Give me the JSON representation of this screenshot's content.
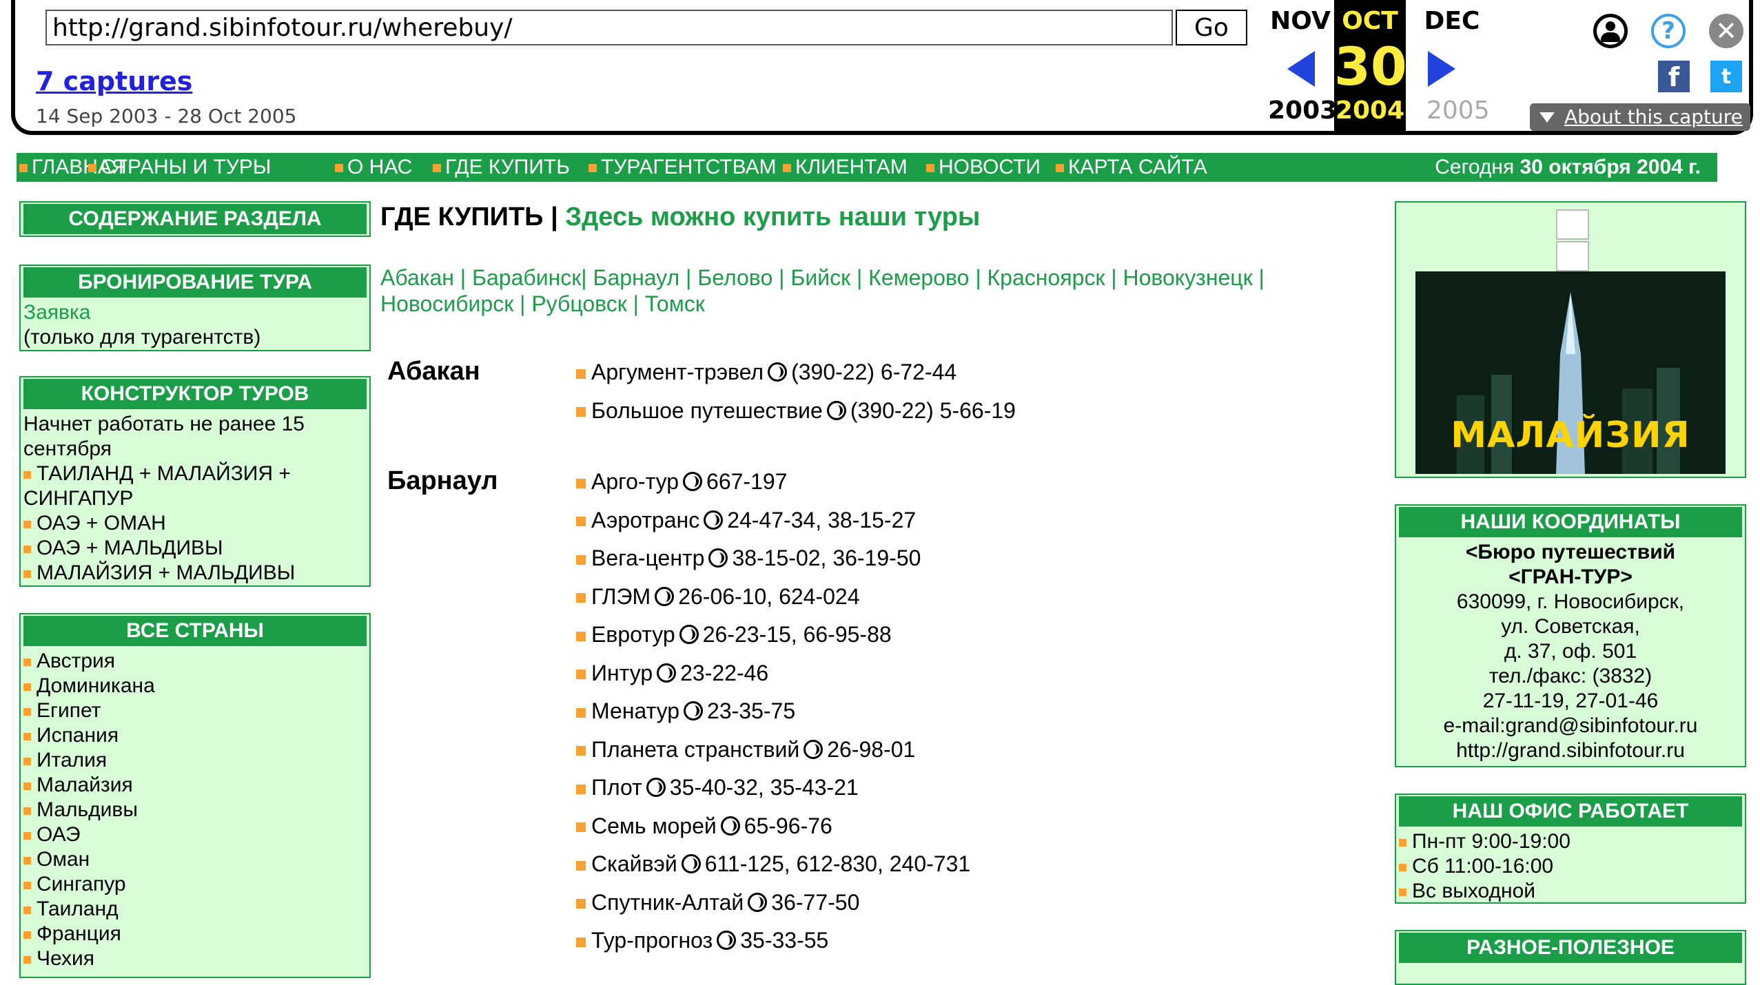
{
  "wayback": {
    "url": "http://grand.sibinfotour.ru/wherebuy/",
    "go_label": "Go",
    "captures": "7 captures",
    "date_range": "14 Sep 2003 - 28 Oct 2005",
    "prev_month": "NOV",
    "cur_month": "OCT",
    "next_month": "DEC",
    "cur_day": "30",
    "prev_year": "2003",
    "cur_year": "2004",
    "next_year": "2005",
    "about": "About this capture",
    "facebook": "f",
    "twitter": "t"
  },
  "nav": {
    "items": [
      "ГЛАВНАЯ",
      "СТРАНЫ И ТУРЫ",
      "О НАС",
      "ГДЕ КУПИТЬ",
      "ТУРАГЕНТСТВАМ",
      "КЛИЕНТАМ",
      "НОВОСТИ",
      "КАРТА САЙТА"
    ],
    "today_label": "Сегодня",
    "today_date": "30 октября 2004 г."
  },
  "left": {
    "contents_title": "СОДЕРЖАНИЕ РАЗДЕЛА",
    "booking_title": "БРОНИРОВАНИЕ ТУРА",
    "booking_link": "Заявка",
    "booking_note": "(только для турагентств)",
    "constructor_title": "КОНСТРУКТОР ТУРОВ",
    "constructor_note_1": "Начнет работать не ранее 15",
    "constructor_note_2": "сентября",
    "constructor_items": [
      "ТАИЛАНД + МАЛАЙЗИЯ +",
      "СИНГАПУР",
      "ОАЭ + ОМАН",
      "ОАЭ + МАЛЬДИВЫ",
      "МАЛАЙЗИЯ + МАЛЬДИВЫ"
    ],
    "countries_title": "ВСЕ СТРАНЫ",
    "countries": [
      "Австрия",
      "Доминикана",
      "Египет",
      "Испания",
      "Италия",
      "Малайзия",
      "Мальдивы",
      "ОАЭ",
      "Оман",
      "Сингапур",
      "Таиланд",
      "Франция",
      "Чехия"
    ]
  },
  "main": {
    "title": "ГДЕ КУПИТЬ",
    "separator": "|",
    "subtitle": "Здесь можно купить наши туры",
    "cities_line1": "Абакан | Барабинск| Барнаул | Белово | Бийск | Кемерово | Красноярск | Новокузнецк |",
    "cities_line2": "Новосибирск | Рубцовск | Томск",
    "sections": [
      {
        "city": "Абакан",
        "agencies": [
          {
            "name": "Аргумент-трэвел",
            "phone": "(390-22) 6-72-44"
          },
          {
            "name": "Большое путешествие",
            "phone": "(390-22) 5-66-19"
          }
        ]
      },
      {
        "city": "Барнаул",
        "agencies": [
          {
            "name": "Арго-тур",
            "phone": "667-197"
          },
          {
            "name": "Аэротранс",
            "phone": "24-47-34, 38-15-27"
          },
          {
            "name": "Вега-центр",
            "phone": "38-15-02, 36-19-50"
          },
          {
            "name": "ГЛЭМ",
            "phone": "26-06-10, 624-024"
          },
          {
            "name": "Евротур",
            "phone": "26-23-15, 66-95-88"
          },
          {
            "name": "Интур",
            "phone": "23-22-46"
          },
          {
            "name": "Менатур",
            "phone": "23-35-75"
          },
          {
            "name": "Планета странствий",
            "phone": "26-98-01"
          },
          {
            "name": "Плот",
            "phone": "35-40-32, 35-43-21"
          },
          {
            "name": "Семь морей",
            "phone": "65-96-76"
          },
          {
            "name": "Скайвэй",
            "phone": "611-125, 612-830, 240-731"
          },
          {
            "name": "Спутник-Алтай",
            "phone": "36-77-50"
          },
          {
            "name": "Тур-прогноз",
            "phone": "35-33-55"
          }
        ]
      }
    ]
  },
  "right": {
    "banner_text": "МАЛАЙЗИЯ",
    "coords_title": "НАШИ КООРДИНАТЫ",
    "coords_lines": [
      "<Бюро путешествий",
      "<ГРАН-ТУР>",
      "630099, г. Новосибирск,",
      "ул. Советская,",
      "д. 37, оф. 501",
      "тел./факс: (3832)",
      "27-11-19, 27-01-46",
      "e-mail:grand@sibinfotour.ru",
      "http://grand.sibinfotour.ru"
    ],
    "office_title": "НАШ ОФИС РАБОТАЕТ",
    "office_lines": [
      "Пн-пт 9:00-19:00",
      "Сб 11:00-16:00",
      "Вс выходной"
    ],
    "misc_title": "РАЗНОЕ-ПОЛЕЗНОЕ"
  },
  "colors": {
    "site_green": "#1a9e48",
    "box_bg": "#d8fbd8",
    "bullet_orange": "#f8a030",
    "wayback_yellow": "#ffec3d",
    "wayback_blue": "#2244dd"
  }
}
